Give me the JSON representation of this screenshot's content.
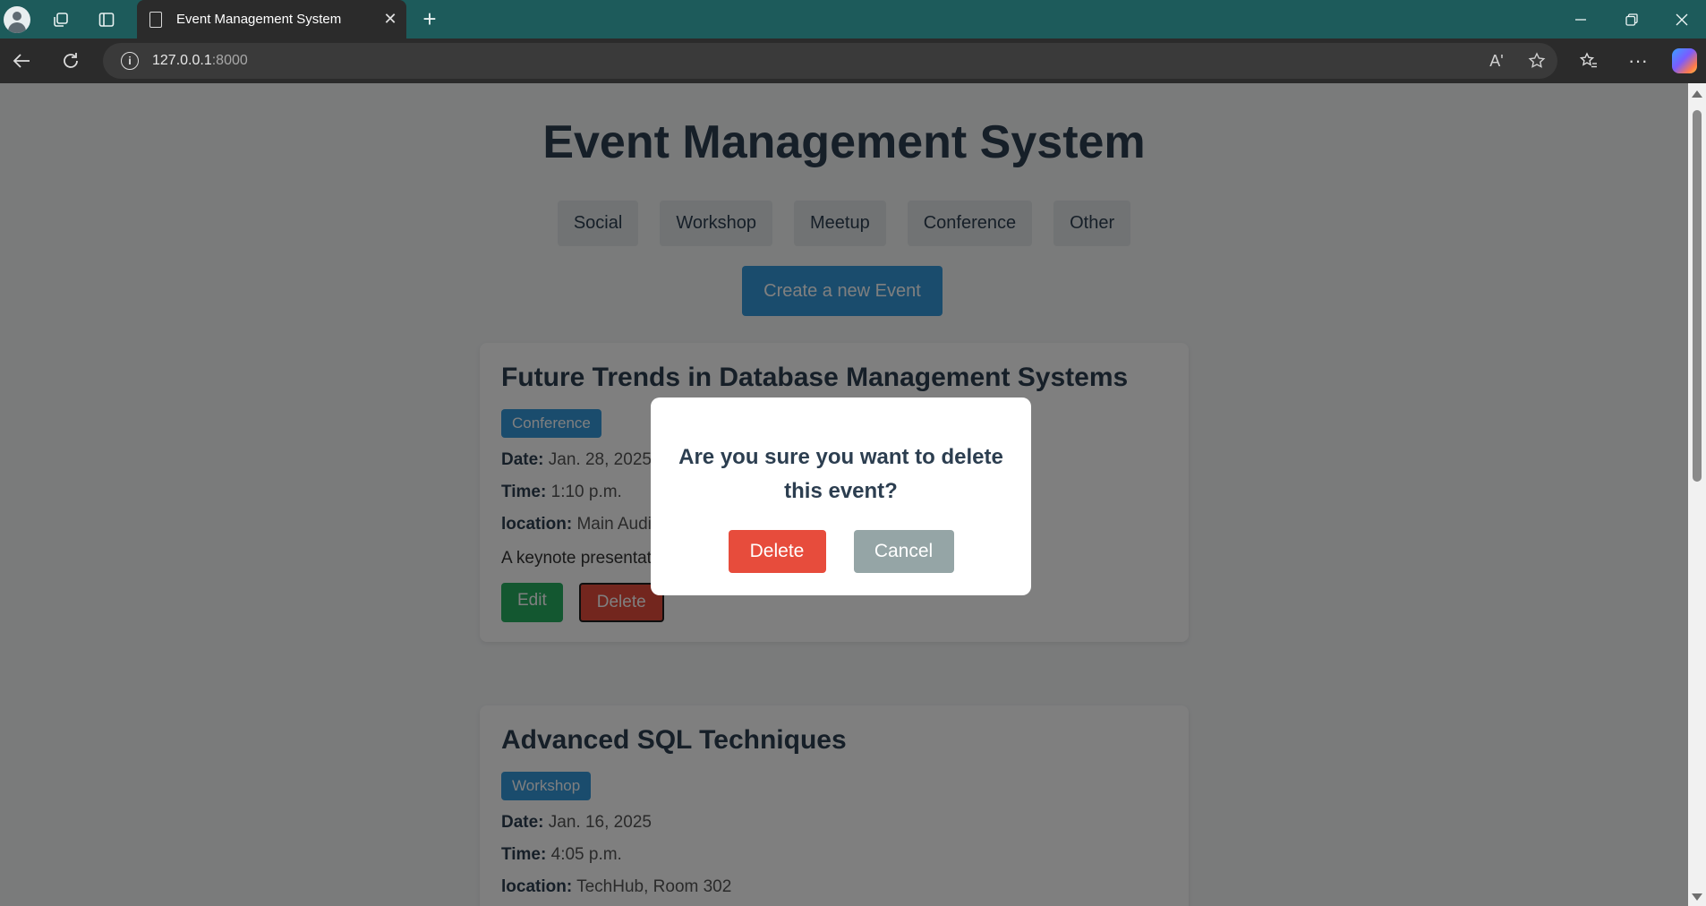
{
  "browser": {
    "tab_title": "Event Management System",
    "tab_close": "✕",
    "new_tab": "+",
    "url_host": "127.0.0.1",
    "url_port": ":8000",
    "icons": [
      "profile-icon",
      "workspaces-icon",
      "tab-actions-icon",
      "document-icon",
      "back-icon",
      "refresh-icon",
      "info-icon",
      "read-aloud-icon",
      "favorite-star-icon",
      "favorites-icon",
      "more-icon",
      "copilot-icon",
      "minimize-icon",
      "restore-icon",
      "close-window-icon"
    ],
    "read_aloud_label": "Aʹ",
    "more_label": "···"
  },
  "page": {
    "title": "Event Management System",
    "categories": [
      "Social",
      "Workshop",
      "Meetup",
      "Conference",
      "Other"
    ],
    "create_button": "Create a new Event"
  },
  "events": [
    {
      "title": "Future Trends in Database Management Systems",
      "category": "Conference",
      "date_label": "Date:",
      "date": "Jan. 28, 2025",
      "time_label": "Time:",
      "time": "1:10 p.m.",
      "location_label": "location:",
      "location": "Main Auditorium",
      "description": "A keynote presentation",
      "edit_label": "Edit",
      "delete_label": "Delete"
    },
    {
      "title": "Advanced SQL Techniques",
      "category": "Workshop",
      "date_label": "Date:",
      "date": "Jan. 16, 2025",
      "time_label": "Time:",
      "time": "4:05 p.m.",
      "location_label": "location:",
      "location": "TechHub, Room 302"
    }
  ],
  "modal": {
    "question": "Are you sure you want to delete this event?",
    "delete_label": "Delete",
    "cancel_label": "Cancel"
  },
  "colors": {
    "tabbar": "#1d5b5b",
    "primary": "#3498db",
    "danger": "#e74c3c",
    "success": "#27ae60",
    "muted": "#95a5a6",
    "heading": "#2c3e50"
  }
}
